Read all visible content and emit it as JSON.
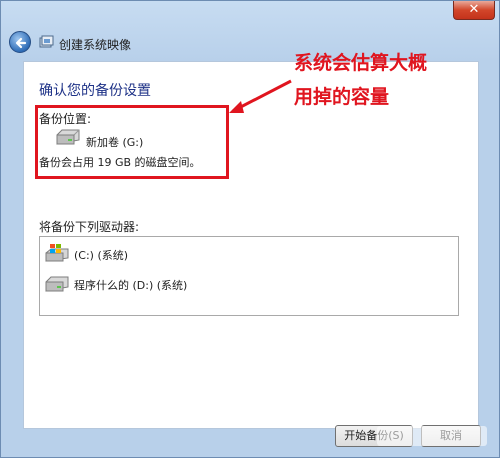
{
  "window": {
    "title": "创建系统映像",
    "close_glyph": "✕"
  },
  "content": {
    "heading": "确认您的备份设置",
    "backup_location_label": "备份位置:",
    "target_drive": "新加卷 (G:)",
    "space_usage": "备份会占用 19 GB 的磁盘空间。",
    "drives_label": "将备份下列驱动器:",
    "drives": [
      {
        "label": "(C:) (系统)",
        "icon": "windows-drive-icon"
      },
      {
        "label": "程序什么的 (D:) (系统)",
        "icon": "hard-drive-icon"
      }
    ]
  },
  "annotation": {
    "line1": "系统会估算大概",
    "line2": "用掉的容量",
    "color": "#e0151f"
  },
  "buttons": {
    "start_backup": "开始备份(S)",
    "cancel": "取消"
  },
  "colors": {
    "heading": "#1e3287",
    "highlight": "#e0151f"
  }
}
